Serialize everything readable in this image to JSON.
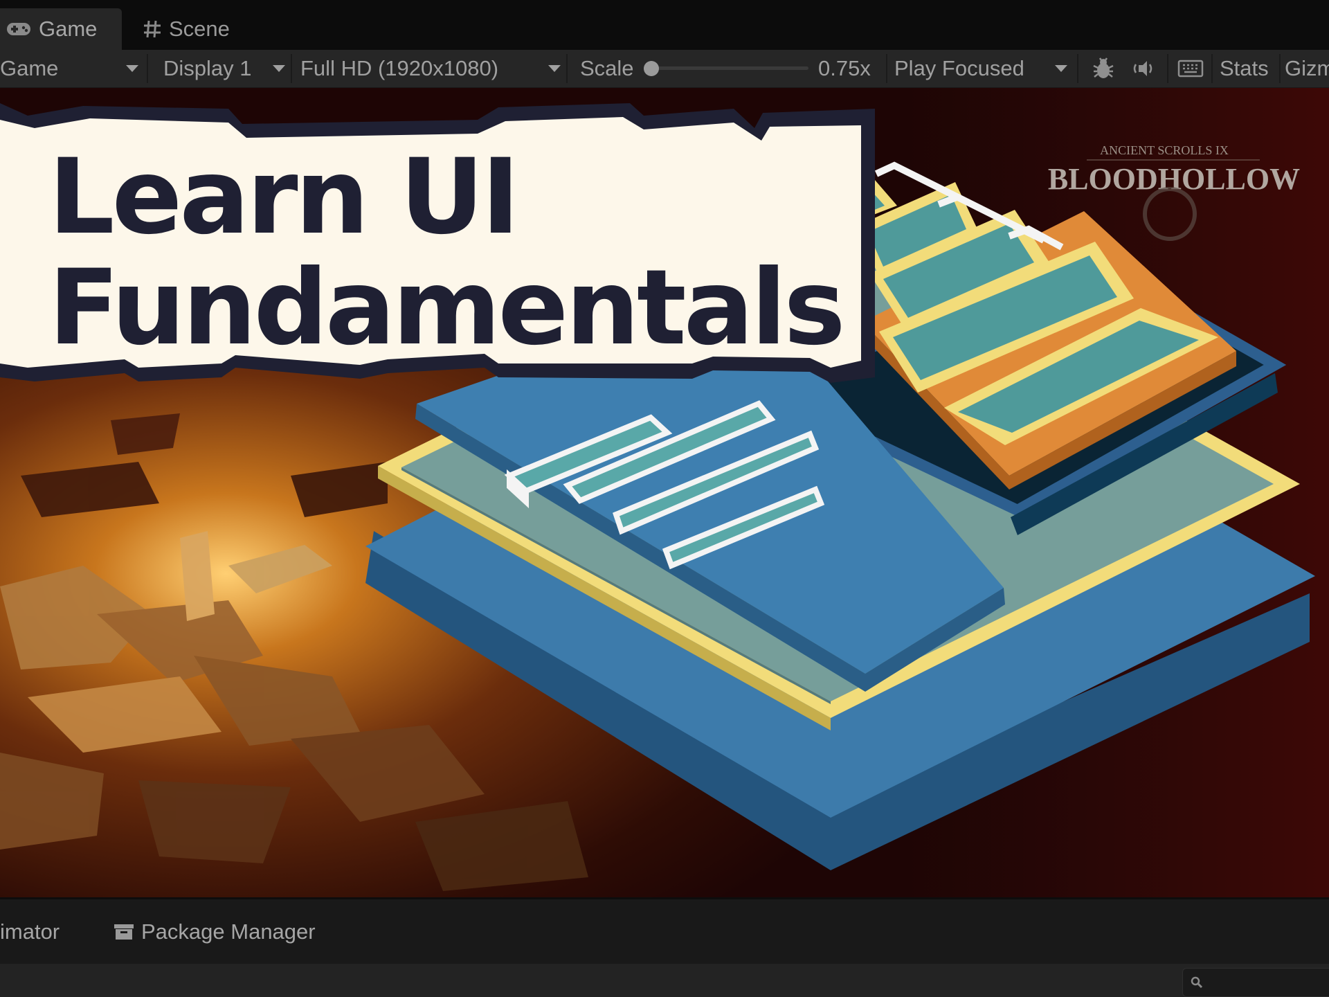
{
  "tabs": {
    "game": "Game",
    "scene": "Scene"
  },
  "toolbar": {
    "game_view": "Game",
    "display": "Display 1",
    "resolution": "Full HD (1920x1080)",
    "scale_label": "Scale",
    "scale_value": "0.75x",
    "play_mode": "Play Focused",
    "stats": "Stats",
    "gizmos": "Gizm"
  },
  "viewport": {
    "logo_subtitle": "ANCIENT SCROLLS IX",
    "logo_title": "BLOODHOLLOW"
  },
  "title": {
    "line1": "Learn UI",
    "line2": "Fundamentals"
  },
  "bottom_tabs": {
    "animator": "imator",
    "package_manager": "Package Manager"
  },
  "icons": {
    "game_tab": "gamepad-icon",
    "scene_tab": "grid-hash-icon",
    "debug": "bug-icon",
    "audio": "speaker-icon",
    "keyboard": "keyboard-icon",
    "package": "package-icon",
    "search": "search-icon"
  },
  "colors": {
    "title_card_bg": "#fdf7ea",
    "title_text": "#1f2033",
    "layer_blue": "#3d7bab",
    "layer_yellow": "#f2dc7a",
    "layer_teal": "#4f9a9a",
    "layer_orange": "#e08a38"
  }
}
